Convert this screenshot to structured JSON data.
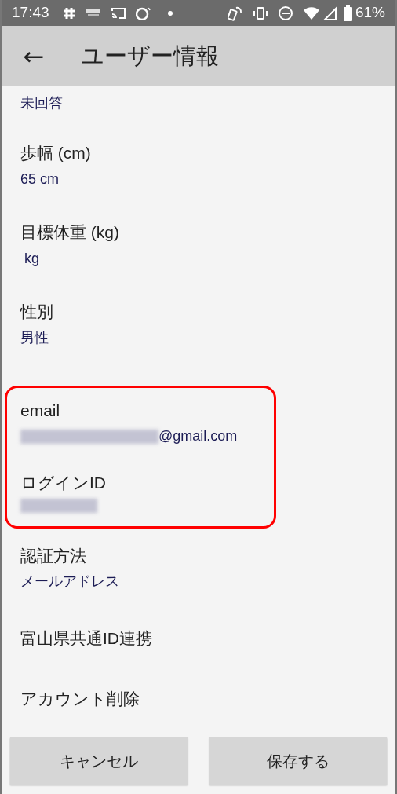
{
  "status_bar": {
    "time": "17:43",
    "battery": "61%"
  },
  "app_bar": {
    "back": "←",
    "title": "ユーザー情報"
  },
  "items": [
    {
      "value": "未回答",
      "highlighted": false
    },
    {
      "label": "歩幅 (cm)",
      "value": "65 cm",
      "highlighted": false
    },
    {
      "label": "目標体重 (kg)",
      "value": " kg",
      "highlighted": false
    },
    {
      "label": "性別",
      "value": "男性",
      "highlighted": false
    },
    {
      "label": "email",
      "value": "@gmail.com",
      "redacted": true,
      "highlighted": true
    },
    {
      "label": "ログインID",
      "redacted": true,
      "highlighted": true
    },
    {
      "label": "認証方法",
      "value": "メールアドレス",
      "highlighted": false
    },
    {
      "label": "富山県共通ID連携",
      "highlighted": false
    },
    {
      "label": "アカウント削除",
      "highlighted": false
    }
  ],
  "buttons": [
    "キャンセル",
    "保存する"
  ]
}
